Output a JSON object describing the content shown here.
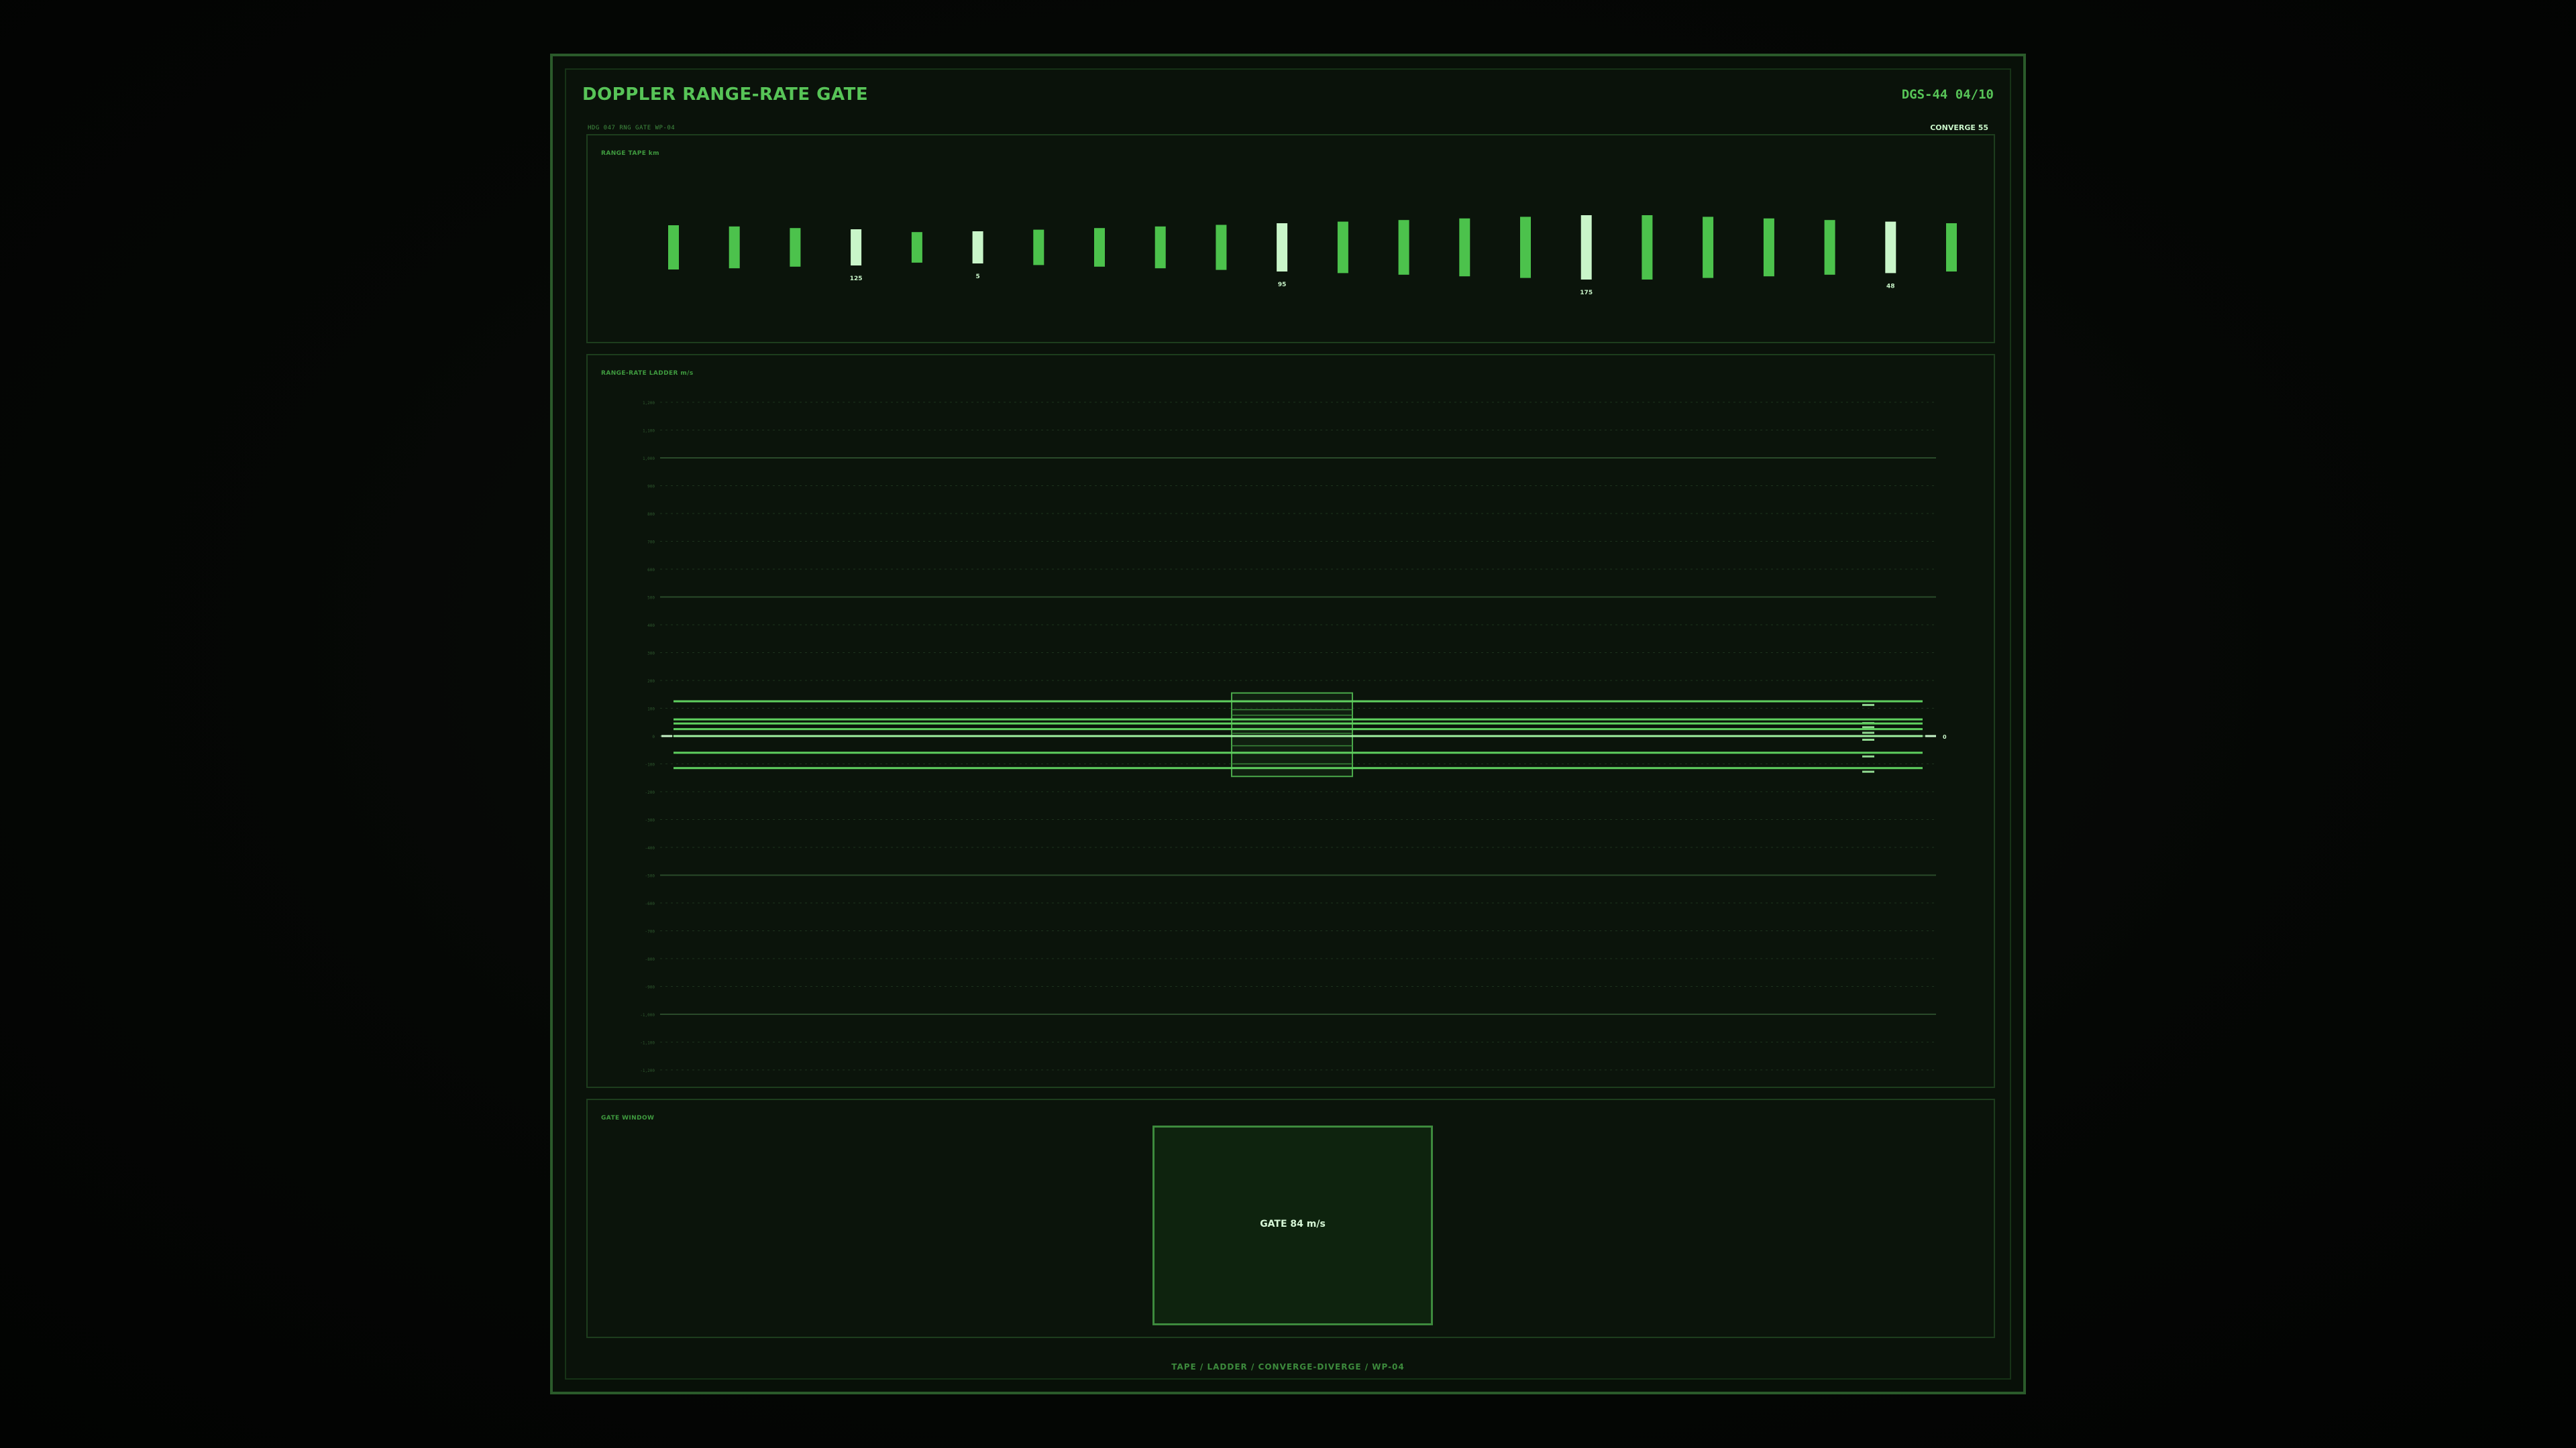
{
  "header": {
    "title": "DOPPLER RANGE-RATE GATE",
    "code": "DGS-44 04/10",
    "subtitle": "HDG 047  RNG GATE  WP-04",
    "status": "CONVERGE 55"
  },
  "tape": {
    "label": "RANGE TAPE km",
    "bars": [
      {
        "value": 0.55,
        "highlight": false,
        "label": ""
      },
      {
        "value": 0.52,
        "highlight": false,
        "label": ""
      },
      {
        "value": 0.48,
        "highlight": false,
        "label": ""
      },
      {
        "value": 0.45,
        "highlight": true,
        "label": "125"
      },
      {
        "value": 0.38,
        "highlight": false,
        "label": ""
      },
      {
        "value": 0.4,
        "highlight": true,
        "label": "5"
      },
      {
        "value": 0.44,
        "highlight": false,
        "label": ""
      },
      {
        "value": 0.48,
        "highlight": false,
        "label": ""
      },
      {
        "value": 0.52,
        "highlight": false,
        "label": ""
      },
      {
        "value": 0.56,
        "highlight": false,
        "label": ""
      },
      {
        "value": 0.6,
        "highlight": true,
        "label": "95"
      },
      {
        "value": 0.64,
        "highlight": false,
        "label": ""
      },
      {
        "value": 0.68,
        "highlight": false,
        "label": ""
      },
      {
        "value": 0.72,
        "highlight": false,
        "label": ""
      },
      {
        "value": 0.76,
        "highlight": false,
        "label": ""
      },
      {
        "value": 0.8,
        "highlight": true,
        "label": "175"
      },
      {
        "value": 0.8,
        "highlight": false,
        "label": ""
      },
      {
        "value": 0.76,
        "highlight": false,
        "label": ""
      },
      {
        "value": 0.72,
        "highlight": false,
        "label": ""
      },
      {
        "value": 0.68,
        "highlight": false,
        "label": ""
      },
      {
        "value": 0.64,
        "highlight": true,
        "label": "48"
      },
      {
        "value": 0.6,
        "highlight": false,
        "label": ""
      }
    ]
  },
  "ladder": {
    "label": "RANGE-RATE LADDER m/s",
    "ylim": [
      -1200,
      1200
    ],
    "tick_step": 100,
    "major_step": 500,
    "center_marker": "0",
    "lines": [
      {
        "value": 125,
        "label": "",
        "bright": false
      },
      {
        "value": 60,
        "label": "",
        "bright": false
      },
      {
        "value": 45,
        "label": "",
        "bright": false
      },
      {
        "value": 25,
        "label": "",
        "bright": false
      },
      {
        "value": 0,
        "label": "",
        "bright": true
      },
      {
        "value": -60,
        "label": "",
        "bright": false
      },
      {
        "value": -115,
        "label": "",
        "bright": false
      }
    ],
    "gate": {
      "low": -145,
      "high": 155
    },
    "gate_rules": [
      95,
      75,
      45,
      10,
      -35,
      -60,
      -100
    ]
  },
  "gate_window": {
    "label": "GATE WINDOW",
    "text": "GATE 84 m/s"
  },
  "footer": "TAPE / LADDER  /  CONVERGE-DIVERGE  /  WP-04",
  "colors": {
    "bar": "#4cc24c",
    "bar_highlight": "#c9f5c9",
    "line": "#5fd05f",
    "grid": "#1d331d",
    "grid_major": "#2a4a2a",
    "tick_text": "#2f5a2f"
  }
}
